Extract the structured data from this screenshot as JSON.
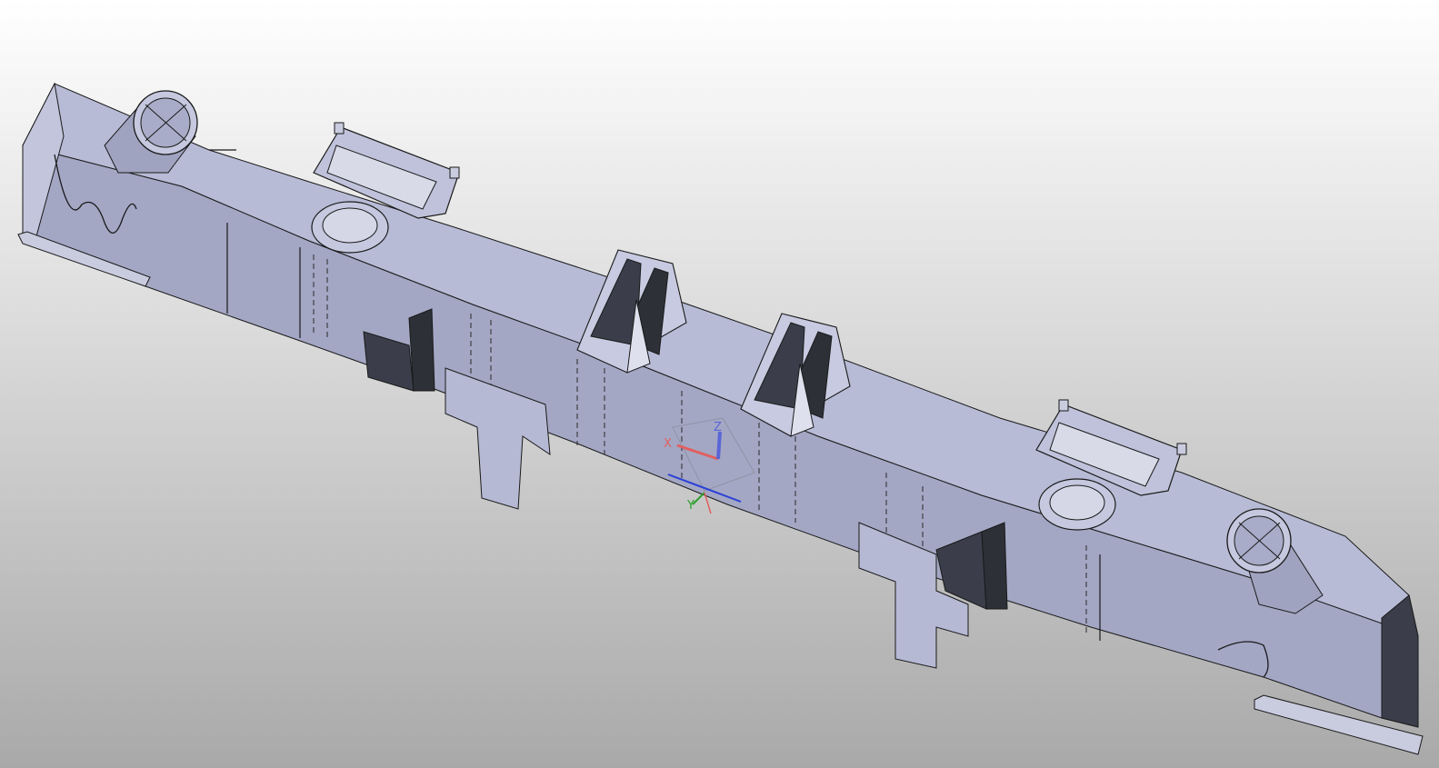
{
  "viewport": {
    "background_top": "#ffffff",
    "background_bottom": "#a9a9a9"
  },
  "model": {
    "face_color": "#b5b9d3",
    "shadow_color": "#9a9ebb",
    "dark_color": "#3b3e4a",
    "edge_color": "#1a1a1a"
  },
  "triad": {
    "x_label": "X",
    "y_label": "Y",
    "z_label": "Z",
    "x_color": "#e06060",
    "y_color": "#2ca02c",
    "z_color": "#5a66d6"
  }
}
